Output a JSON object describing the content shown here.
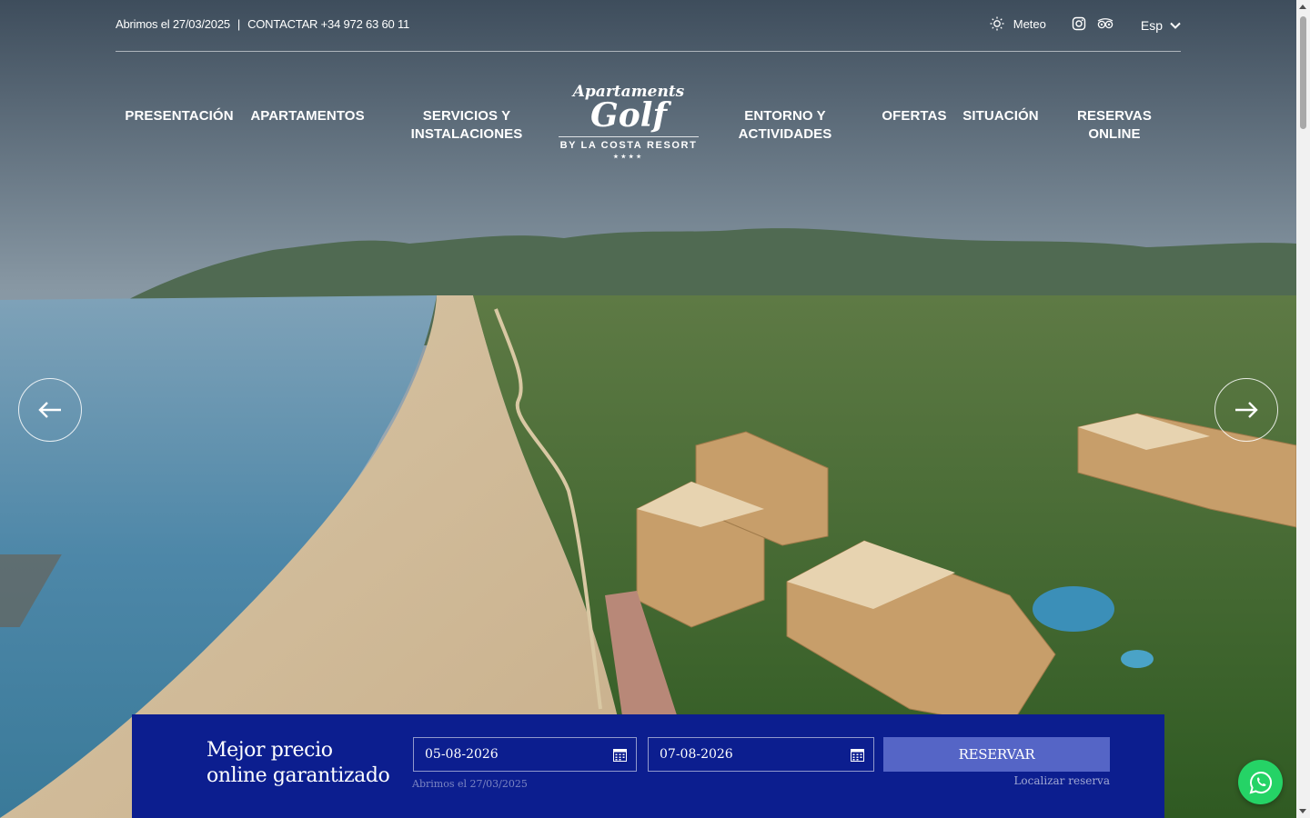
{
  "topbar": {
    "opening": "Abrimos el 27/03/2025",
    "separator": "|",
    "contact": "CONTACTAR +34 972 63 60 11",
    "meteo_label": "Meteo",
    "language": "Esp",
    "icons": [
      "sun-icon",
      "instagram-icon",
      "tripadvisor-icon",
      "chevron-down-icon"
    ]
  },
  "nav": {
    "items": [
      {
        "label": "PRESENTACIÓN"
      },
      {
        "label": "APARTAMENTOS"
      },
      {
        "label": "SERVICIOS Y\nINSTALACIONES"
      },
      {
        "label": "ENTORNO Y\nACTIVIDADES"
      },
      {
        "label": "OFERTAS"
      },
      {
        "label": "SITUACIÓN"
      },
      {
        "label": "RESERVAS\nONLINE"
      }
    ]
  },
  "logo": {
    "line1": "Apartaments",
    "line2": "Golf",
    "by": "BY",
    "brand": "LA COSTA",
    "resort": "RESORT",
    "stars": "★★★★"
  },
  "slider": {
    "prev_icon": "arrow-left-icon",
    "next_icon": "arrow-right-icon"
  },
  "booking": {
    "title_line1": "Mejor precio",
    "title_line2": "online garantizado",
    "checkin": "05-08-2026",
    "checkout": "07-08-2026",
    "button": "RESERVAR",
    "note": "Abrimos el 27/03/2025",
    "locate": "Localizar reserva",
    "calendar_icon": "calendar-icon"
  },
  "whatsapp_icon": "whatsapp-icon",
  "colors": {
    "booking_bg": "#0c1e8f",
    "button_bg": "#5565c6",
    "whatsapp": "#25d366"
  }
}
